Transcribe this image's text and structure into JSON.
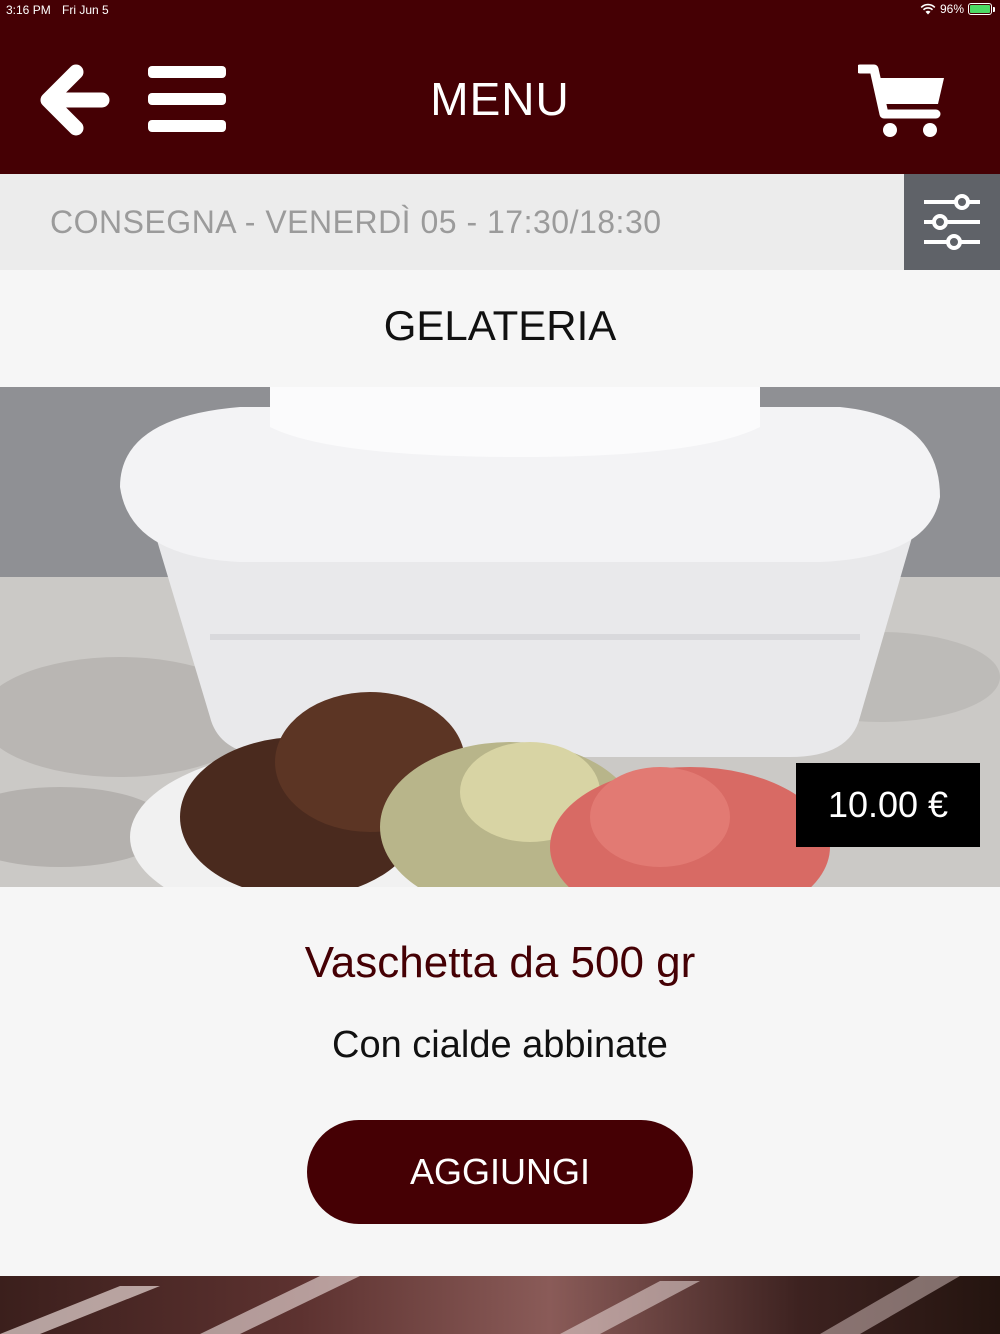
{
  "status_bar": {
    "time": "3:16 PM",
    "date": "Fri Jun 5",
    "battery": "96%"
  },
  "header": {
    "title": "MENU",
    "back_icon": "arrow-left-icon",
    "menu_icon": "hamburger-icon",
    "cart_icon": "cart-icon"
  },
  "delivery": {
    "text": "CONSEGNA - VENERDÌ 05 - 17:30/18:30",
    "filter_icon": "sliders-icon"
  },
  "category": {
    "title": "GELATERIA"
  },
  "product": {
    "price": "10.00 €",
    "name": "Vaschetta da 500 gr",
    "description": "Con cialde abbinate",
    "add_label": "AGGIUNGI"
  },
  "colors": {
    "brand": "#450004",
    "filter_bg": "#5f6268",
    "delivery_bg": "#ececec",
    "page_bg": "#f6f6f6"
  }
}
